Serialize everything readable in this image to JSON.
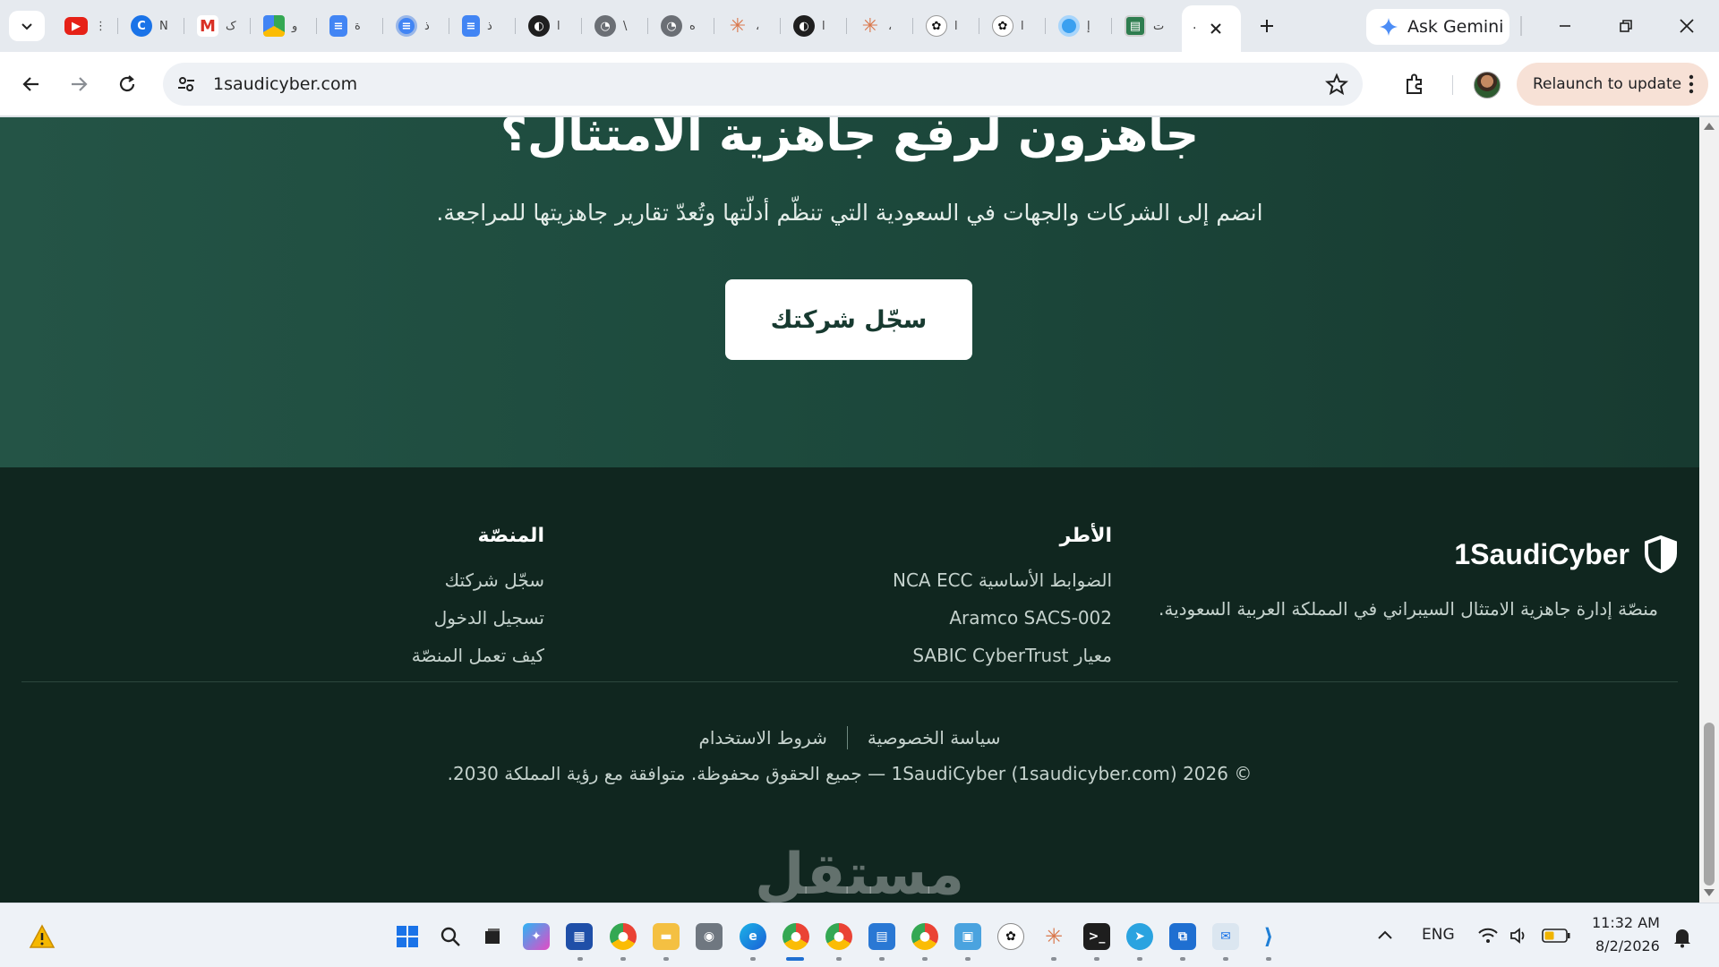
{
  "browser": {
    "tab_truncations": [
      "⋮",
      "N",
      "ک",
      "و",
      "ة",
      "ذ",
      "ذ",
      "ا",
      "\\",
      "ه",
      "،",
      "ا",
      "،",
      "ا",
      "ا",
      "إ",
      "ت"
    ],
    "active_tab_truncation": "·",
    "ask_gemini_label": "Ask Gemini",
    "url": "1saudicyber.com",
    "relaunch_label": "Relaunch to update"
  },
  "cta": {
    "title": "جاهزون لرفع جاهزية الامتثال؟",
    "subtitle": "انضم إلى الشركات والجهات في السعودية التي تنظّم أدلّتها وتُعدّ تقارير جاهزيتها للمراجعة.",
    "button_label": "سجّل شركتك"
  },
  "footer": {
    "brand_name": "1SaudiCyber",
    "tagline": "منصّة إدارة جاهزية الامتثال السيبراني في المملكة العربية السعودية.",
    "frameworks": {
      "title": "الأطر",
      "items": [
        "الضوابط الأساسية NCA ECC",
        "Aramco SACS-002",
        "معيار SABIC CyberTrust"
      ]
    },
    "platform": {
      "title": "المنصّة",
      "items": [
        "سجّل شركتك",
        "تسجيل الدخول",
        "كيف تعمل المنصّة"
      ]
    },
    "privacy_label": "سياسة الخصوصية",
    "terms_label": "شروط الاستخدام",
    "copyright": "© 2026 1SaudiCyber (1saudicyber.com) — جميع الحقوق محفوظة. متوافقة مع رؤية المملكة 2030."
  },
  "watermark": "مستقل",
  "taskbar": {
    "language": "ENG",
    "time": "11:32 AM",
    "date": "8/2/2026"
  },
  "colors": {
    "cta_bg": "#1d4a3d",
    "footer_bg": "#10261f",
    "relaunch_bg": "#f7e1d6"
  }
}
